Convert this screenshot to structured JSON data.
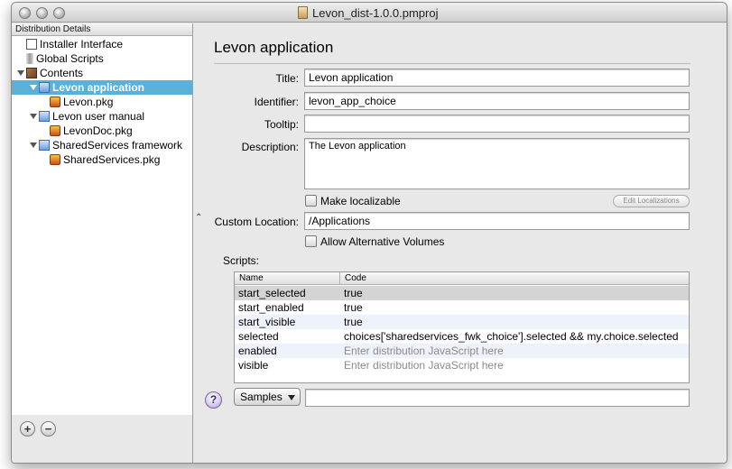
{
  "window": {
    "title": "Levon_dist-1.0.0.pmproj"
  },
  "sidebar": {
    "header": "Distribution Details",
    "items": [
      {
        "label": "Installer Interface",
        "icon": "window-icon"
      },
      {
        "label": "Global Scripts",
        "icon": "script-icon"
      },
      {
        "label": "Contents",
        "icon": "box-icon"
      },
      {
        "label": "Levon application",
        "icon": "folder-icon",
        "selected": true
      },
      {
        "label": "Levon.pkg",
        "icon": "package-icon"
      },
      {
        "label": "Levon user manual",
        "icon": "folder-icon"
      },
      {
        "label": "LevonDoc.pkg",
        "icon": "package-icon"
      },
      {
        "label": "SharedServices framework",
        "icon": "folder-icon"
      },
      {
        "label": "SharedServices.pkg",
        "icon": "package-icon"
      }
    ],
    "add_label": "+",
    "remove_label": "−"
  },
  "main": {
    "heading": "Levon application",
    "title_label": "Title:",
    "title_value": "Levon application",
    "identifier_label": "Identifier:",
    "identifier_value": "levon_app_choice",
    "tooltip_label": "Tooltip:",
    "tooltip_value": "",
    "description_label": "Description:",
    "description_value": "The Levon application",
    "make_localizable_label": "Make localizable",
    "make_localizable_checked": false,
    "edit_localizations_label": "Edit Localizations",
    "custom_location_label": "Custom Location:",
    "custom_location_value": "/Applications",
    "allow_alt_volumes_label": "Allow Alternative Volumes",
    "allow_alt_volumes_checked": false,
    "scripts_label": "Scripts:",
    "scripts_table": {
      "columns": [
        "Name",
        "Code"
      ],
      "rows": [
        {
          "name": "start_selected",
          "code": "true"
        },
        {
          "name": "start_enabled",
          "code": "true"
        },
        {
          "name": "start_visible",
          "code": "true"
        },
        {
          "name": "selected",
          "code": "choices['sharedservices_fwk_choice'].selected && my.choice.selected"
        },
        {
          "name": "enabled",
          "code": "Enter distribution JavaScript here"
        },
        {
          "name": "visible",
          "code": "Enter distribution JavaScript here"
        }
      ]
    },
    "help_label": "?",
    "samples_label": "Samples",
    "samples_field_value": ""
  }
}
